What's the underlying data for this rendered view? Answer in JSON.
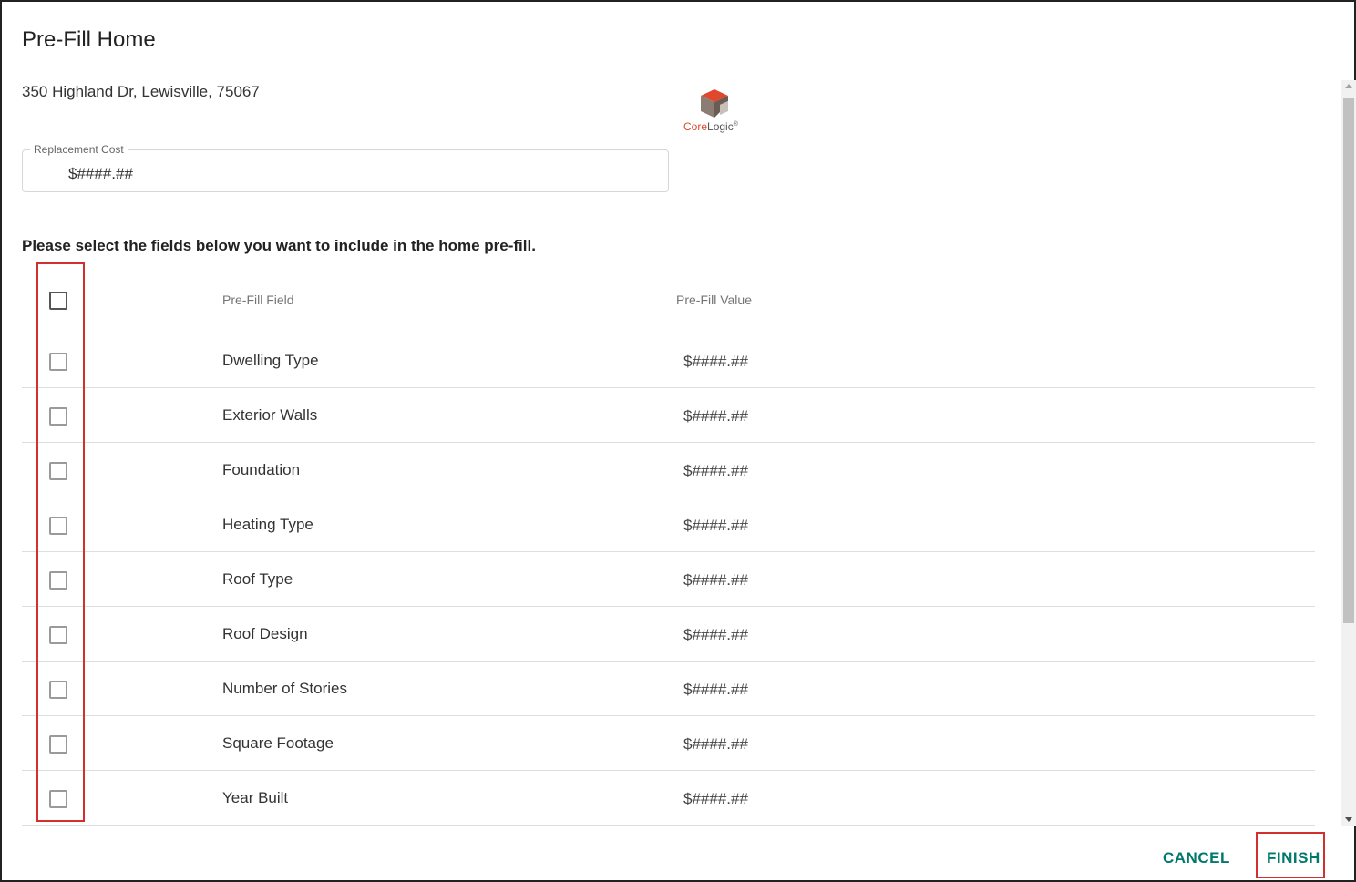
{
  "dialog": {
    "title": "Pre-Fill Home",
    "address": "350 Highland Dr, Lewisville, 75067"
  },
  "logo": {
    "name_part1": "Core",
    "name_part2": "Logic",
    "mark": "®"
  },
  "replacement_cost": {
    "label": "Replacement Cost",
    "value": "$####.##"
  },
  "instruction": "Please select the fields below you want to include in the home pre-fill.",
  "table": {
    "headers": {
      "field": "Pre-Fill Field",
      "value": "Pre-Fill Value"
    },
    "rows": [
      {
        "field": "Dwelling Type",
        "value": "$####.##"
      },
      {
        "field": "Exterior Walls",
        "value": "$####.##"
      },
      {
        "field": "Foundation",
        "value": "$####.##"
      },
      {
        "field": "Heating Type",
        "value": "$####.##"
      },
      {
        "field": "Roof Type",
        "value": "$####.##"
      },
      {
        "field": "Roof Design",
        "value": "$####.##"
      },
      {
        "field": "Number of Stories",
        "value": "$####.##"
      },
      {
        "field": "Square Footage",
        "value": "$####.##"
      },
      {
        "field": "Year Built",
        "value": "$####.##"
      }
    ]
  },
  "buttons": {
    "cancel": "CANCEL",
    "finish": "FINISH"
  },
  "colors": {
    "accent": "#00796b",
    "highlight": "#d32f2f",
    "logo_red": "#e0472f"
  }
}
